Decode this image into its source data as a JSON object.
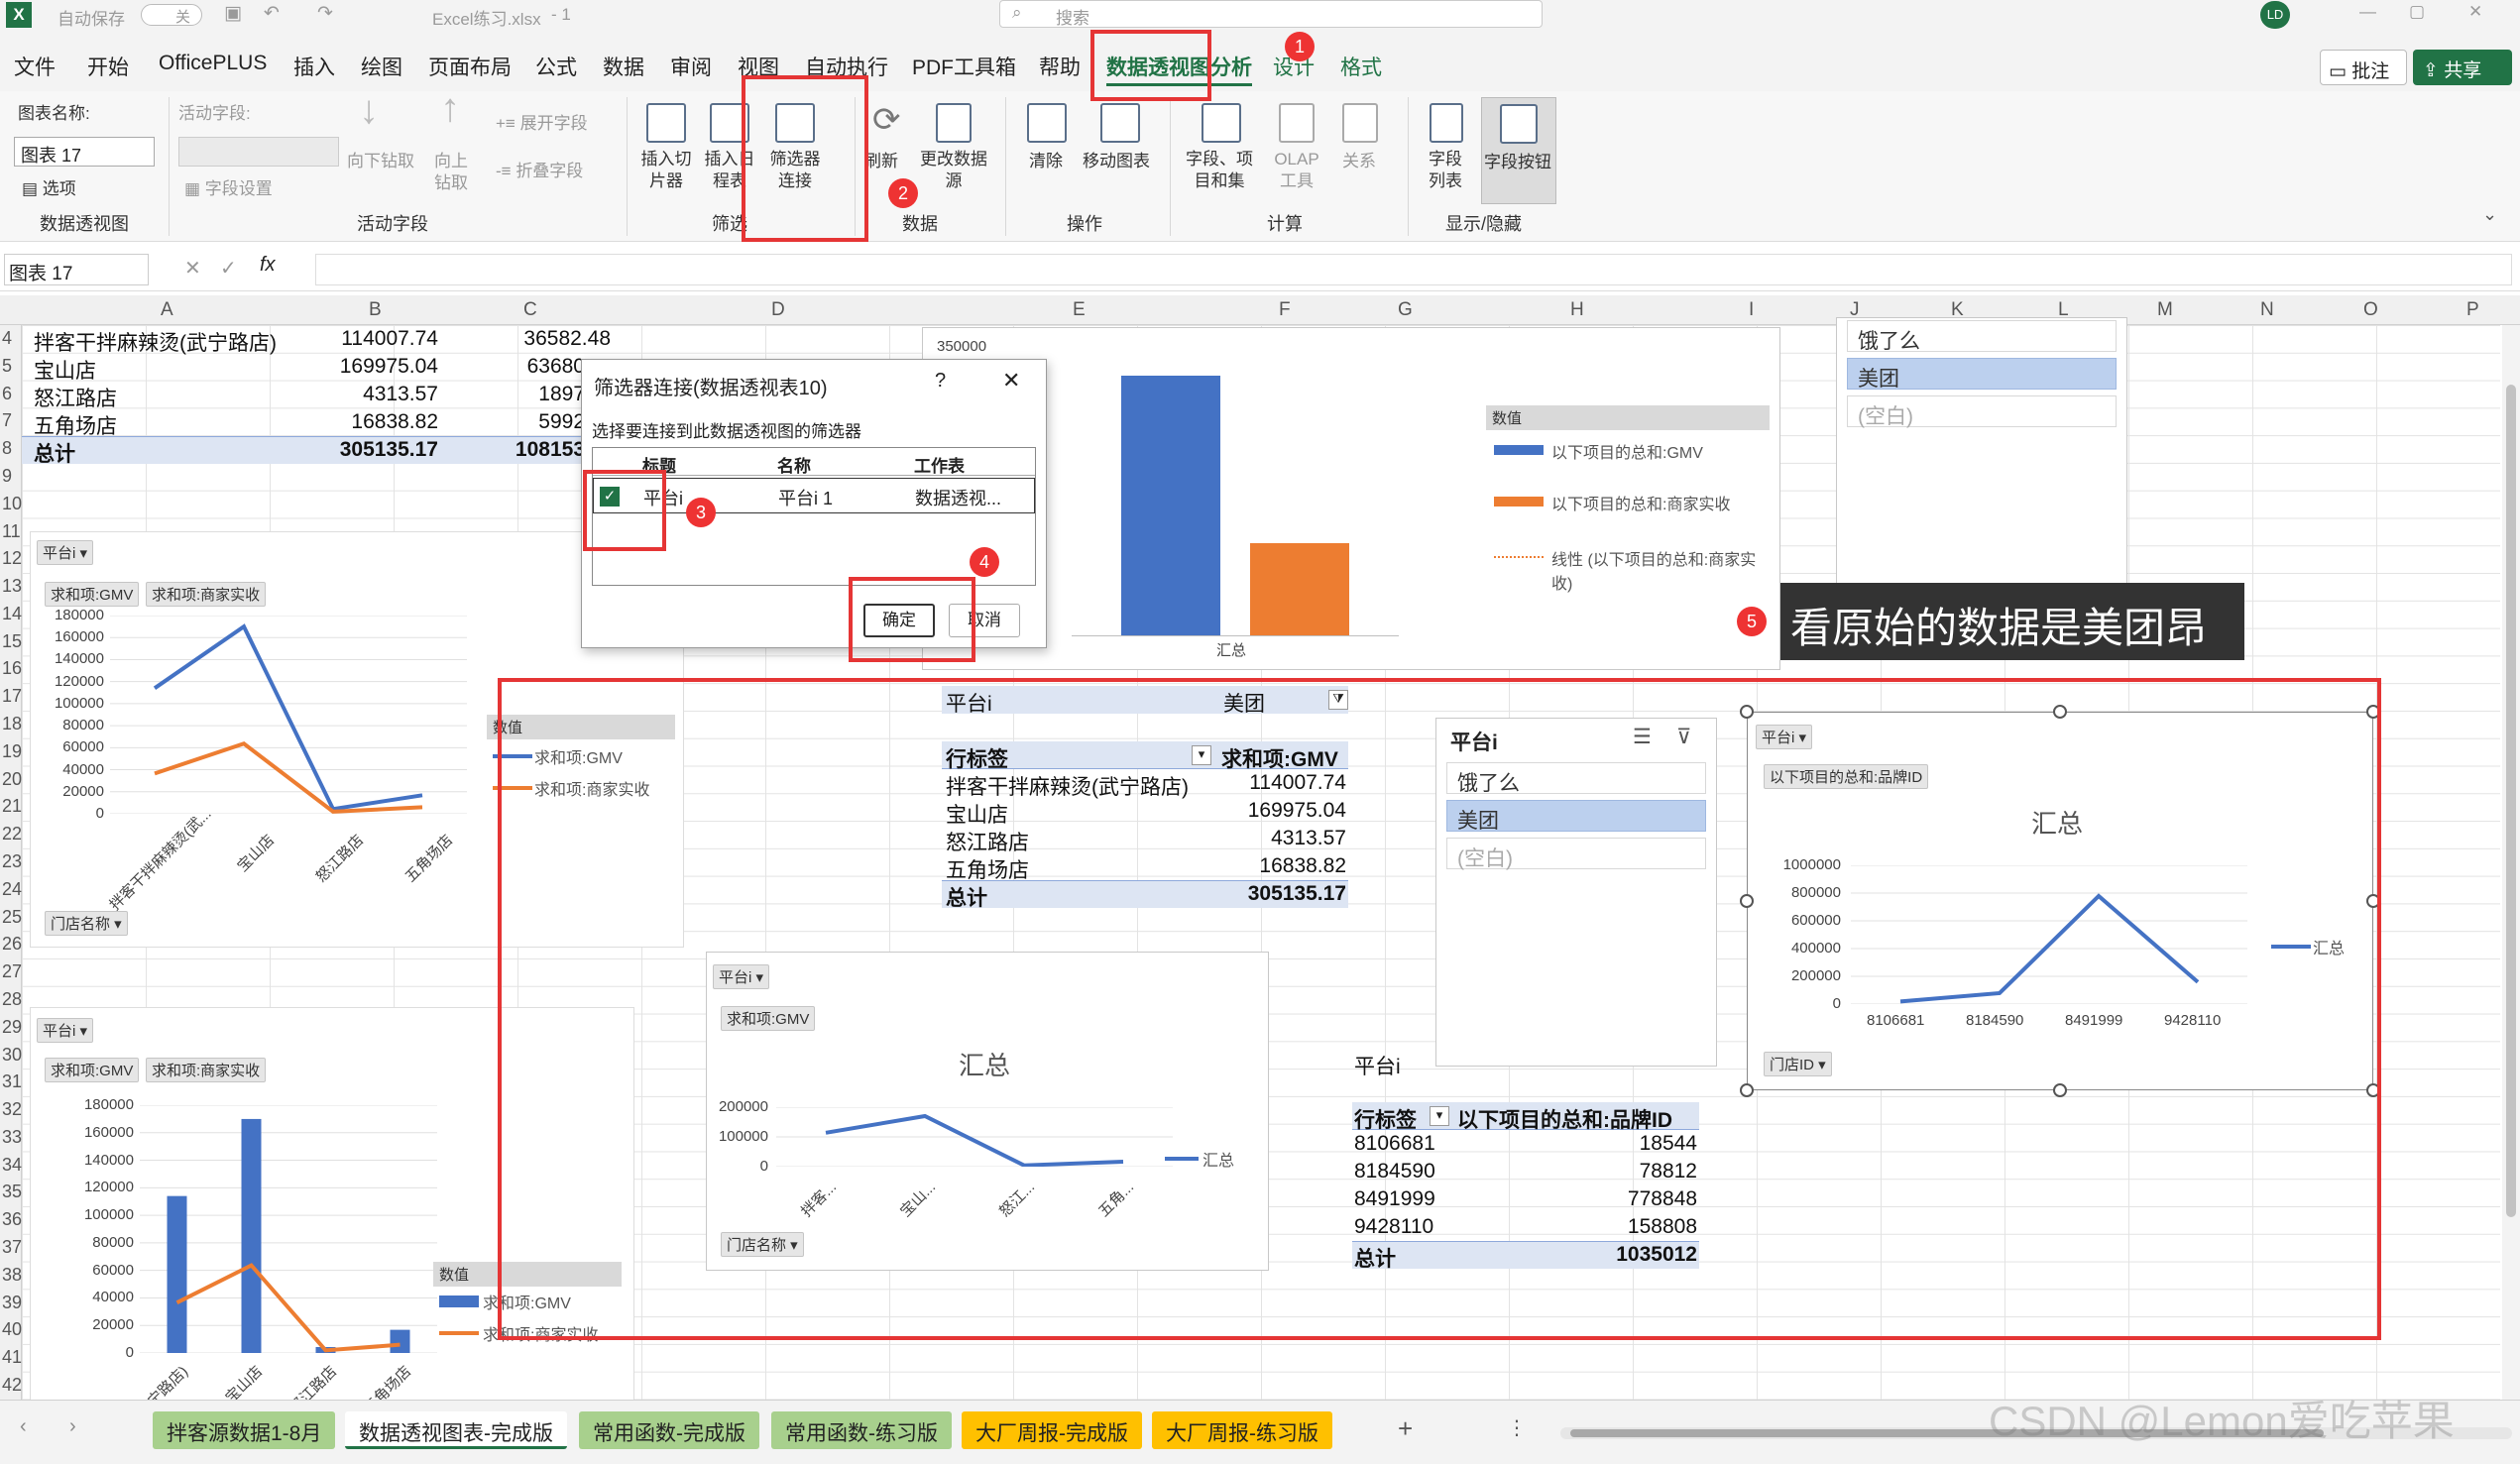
{
  "titlebar": {
    "autosave_label": "自动保存",
    "autosave_state": "关",
    "filename": "Excel练习.xlsx",
    "version_mark": "- 1",
    "search_placeholder": "搜索",
    "user_initials": "LD"
  },
  "menu": {
    "items": [
      "文件",
      "开始",
      "OfficePLUS",
      "插入",
      "绘图",
      "页面布局",
      "公式",
      "数据",
      "审阅",
      "视图",
      "自动执行",
      "PDF工具箱",
      "帮助",
      "数据透视图分析",
      "设计",
      "格式"
    ],
    "comment_btn": "批注",
    "share_btn": "共享"
  },
  "ribbon": {
    "chart_name_label": "图表名称:",
    "chart_name_value": "图表 17",
    "options_label": "选项",
    "group_pivotchart": "数据透视图",
    "active_field_label": "活动字段:",
    "field_settings": "字段设置",
    "drill_down": "向下钻取",
    "drill_up": "向上钻取",
    "expand_field": "展开字段",
    "collapse_field": "折叠字段",
    "group_active_field": "活动字段",
    "insert_slicer": "插入切片器",
    "insert_timeline": "插入日程表",
    "filter_connections": "筛选器连接",
    "group_filter": "筛选",
    "refresh": "刷新",
    "change_source": "更改数据源",
    "group_data": "数据",
    "clear": "清除",
    "move_chart": "移动图表",
    "group_actions": "操作",
    "fields_items_sets": "字段、项目和集",
    "olap_tools": "OLAP工具",
    "relationships": "关系",
    "group_calc": "计算",
    "field_list": "字段列表",
    "field_buttons": "字段按钮",
    "group_show": "显示/隐藏"
  },
  "formula_bar": {
    "name_box": "图表 17",
    "fx": "fx"
  },
  "columns": [
    "A",
    "B",
    "C",
    "D",
    "E",
    "F",
    "G",
    "H",
    "I",
    "J",
    "K",
    "L",
    "M",
    "N",
    "O",
    "P"
  ],
  "rows": [
    "4",
    "5",
    "6",
    "7",
    "8",
    "9",
    "10",
    "11",
    "12",
    "13",
    "14",
    "15",
    "16",
    "17",
    "18",
    "19",
    "20",
    "21",
    "22",
    "23",
    "24",
    "25",
    "26",
    "27",
    "28",
    "29",
    "30",
    "31",
    "32",
    "33",
    "34",
    "35",
    "36",
    "37",
    "38",
    "39",
    "40",
    "41",
    "42"
  ],
  "top_table": {
    "rows": [
      {
        "name": "拌客干拌麻辣烫(武宁路店)",
        "b": "114007.74",
        "c": "36582.48"
      },
      {
        "name": "宝山店",
        "b": "169975.04",
        "c": "63680"
      },
      {
        "name": "怒江路店",
        "b": "4313.57",
        "c": "1897"
      },
      {
        "name": "五角场店",
        "b": "16838.82",
        "c": "5992"
      },
      {
        "name": "总计",
        "b": "305135.17",
        "c": "108153"
      }
    ]
  },
  "dialog": {
    "title": "筛选器连接(数据透视表10)",
    "help": "?",
    "close": "✕",
    "prompt": "选择要连接到此数据透视图的筛选器",
    "headers": [
      "标题",
      "名称",
      "工作表"
    ],
    "row": {
      "title": "平台i",
      "name": "平台i 1",
      "sheet": "数据透视..."
    },
    "ok": "确定",
    "cancel": "取消"
  },
  "bar_chart_top": {
    "ytick": "350000",
    "xlabel": "汇总",
    "legend_title": "数值",
    "legend": [
      "以下项目的总和:GMV",
      "以下项目的总和:商家实收",
      "线性 (以下项目的总和:商家实收)"
    ]
  },
  "slicer_top": {
    "items": [
      "饿了么",
      "美团",
      "(空白)"
    ]
  },
  "annotation": {
    "text": "看原始的数据是美团昂"
  },
  "chart_line1": {
    "filter": "平台i",
    "buttons": [
      "求和项:GMV",
      "求和项:商家实收"
    ],
    "yticks": [
      "180000",
      "160000",
      "140000",
      "120000",
      "100000",
      "80000",
      "60000",
      "40000",
      "20000",
      "0"
    ],
    "cats": [
      "拌客干拌麻辣烫(武...",
      "宝山店",
      "怒江路店",
      "五角场店"
    ],
    "legend_title": "数值",
    "legend": [
      "求和项:GMV",
      "求和项:商家实收"
    ],
    "axis_btn": "门店名称"
  },
  "chart_bar2": {
    "filter": "平台i",
    "buttons": [
      "求和项:GMV",
      "求和项:商家实收"
    ],
    "yticks": [
      "180000",
      "160000",
      "140000",
      "120000",
      "100000",
      "80000",
      "60000",
      "40000",
      "20000",
      "0"
    ],
    "cats": [
      "(武宁路店)",
      "宝山店",
      "怒江路店",
      "五角场店"
    ],
    "legend_title": "数值",
    "legend": [
      "求和项:GMV",
      "求和项:商家实收"
    ]
  },
  "pivot_mid": {
    "filter_label": "平台i",
    "filter_value": "美团",
    "row_label": "行标签",
    "value_label": "求和项:GMV",
    "rows": [
      {
        "k": "拌客干拌麻辣烫(武宁路店)",
        "v": "114007.74"
      },
      {
        "k": "宝山店",
        "v": "169975.04"
      },
      {
        "k": "怒江路店",
        "v": "4313.57"
      },
      {
        "k": "五角场店",
        "v": "16838.82"
      }
    ],
    "total_k": "总计",
    "total_v": "305135.17"
  },
  "slicer_mid": {
    "title": "平台i",
    "items": [
      "饿了么",
      "美团",
      "(空白)"
    ]
  },
  "chart_small": {
    "filter": "平台i",
    "button": "求和项:GMV",
    "title": "汇总",
    "yticks": [
      "200000",
      "100000",
      "0"
    ],
    "cats": [
      "拌客...",
      "宝山...",
      "怒江...",
      "五角..."
    ],
    "legend": "汇总",
    "axis_btn": "门店名称"
  },
  "pivot_brand": {
    "filter_label": "平台i",
    "row_label": "行标签",
    "value_label": "以下项目的总和:品牌ID",
    "rows": [
      {
        "k": "8106681",
        "v": "18544"
      },
      {
        "k": "8184590",
        "v": "78812"
      },
      {
        "k": "8491999",
        "v": "778848"
      },
      {
        "k": "9428110",
        "v": "158808"
      }
    ],
    "total_k": "总计",
    "total_v": "1035012"
  },
  "chart_brand": {
    "filter": "平台i",
    "button": "以下项目的总和:品牌ID",
    "title": "汇总",
    "yticks": [
      "1000000",
      "800000",
      "600000",
      "400000",
      "200000",
      "0"
    ],
    "cats": [
      "8106681",
      "8184590",
      "8491999",
      "9428110"
    ],
    "legend": "汇总",
    "axis_btn": "门店ID"
  },
  "badges": [
    "1",
    "2",
    "3",
    "4",
    "5"
  ],
  "sheet_tabs": [
    "拌客源数据1-8月",
    "数据透视图表-完成版",
    "常用函数-完成版",
    "常用函数-练习版",
    "大厂周报-完成版",
    "大厂周报-练习版"
  ],
  "watermark": "CSDN @Lemon爱吃苹果",
  "colors": {
    "excel_green": "#217346",
    "gmv_blue": "#4472c4",
    "orange": "#ed7d31",
    "red_box": "#e53535",
    "tab_green": "#a8d08d",
    "tab_yellow": "#ffc000"
  },
  "chart_data": [
    {
      "type": "bar",
      "categories": [
        "汇总"
      ],
      "series": [
        {
          "name": "以下项目的总和:GMV",
          "values": [
            305135
          ]
        },
        {
          "name": "以下项目的总和:商家实收",
          "values": [
            108153
          ]
        }
      ]
    },
    {
      "type": "line",
      "categories": [
        "拌客干拌麻辣烫(武宁路店)",
        "宝山店",
        "怒江路店",
        "五角场店"
      ],
      "series": [
        {
          "name": "求和项:GMV",
          "values": [
            114008,
            169975,
            4314,
            16839
          ]
        },
        {
          "name": "求和项:商家实收",
          "values": [
            36582,
            63680,
            1897,
            5992
          ]
        }
      ],
      "ylim": [
        0,
        180000
      ]
    },
    {
      "type": "bar",
      "categories": [
        "拌客干拌麻辣烫(武宁路店)",
        "宝山店",
        "怒江路店",
        "五角场店"
      ],
      "series": [
        {
          "name": "求和项:GMV",
          "values": [
            114008,
            169975,
            4314,
            16839
          ]
        },
        {
          "name": "求和项:商家实收",
          "values": [
            36582,
            63680,
            1897,
            5992
          ]
        }
      ],
      "ylim": [
        0,
        180000
      ]
    },
    {
      "type": "line",
      "title": "汇总",
      "categories": [
        "拌客干拌麻辣烫(武宁路店)",
        "宝山店",
        "怒江路店",
        "五角场店"
      ],
      "series": [
        {
          "name": "汇总",
          "values": [
            114008,
            169975,
            4314,
            16839
          ]
        }
      ],
      "ylim": [
        0,
        200000
      ]
    },
    {
      "type": "line",
      "title": "汇总",
      "categories": [
        "8106681",
        "8184590",
        "8491999",
        "9428110"
      ],
      "series": [
        {
          "name": "汇总",
          "values": [
            18544,
            78812,
            778848,
            158808
          ]
        }
      ],
      "ylim": [
        0,
        1000000
      ]
    }
  ]
}
